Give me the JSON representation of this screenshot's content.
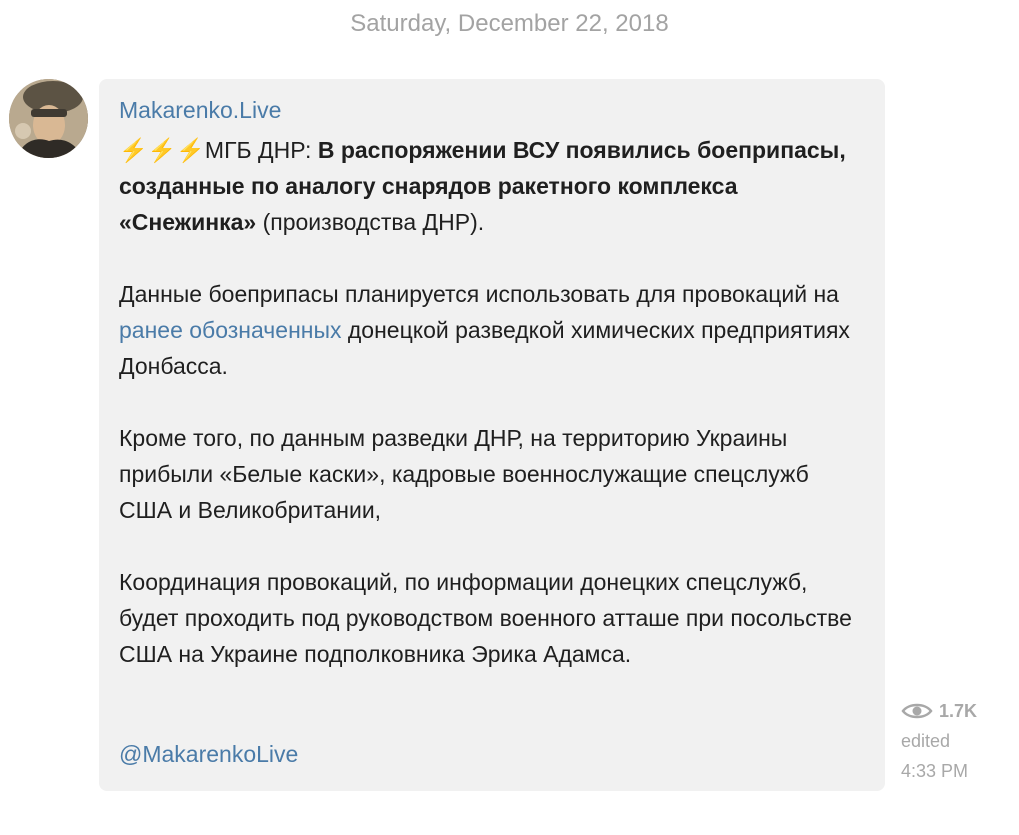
{
  "date_header": "Saturday, December 22, 2018",
  "message": {
    "channel_name": "Makarenko.Live",
    "p1": {
      "bolts": "⚡⚡⚡",
      "prefix": "МГБ ДНР: ",
      "bold": "В распоряжении ВСУ появились боеприпасы, созданные по аналогу снарядов ракетного комплекса «Снежинка»",
      "suffix": " (производства ДНР)."
    },
    "p2": {
      "before_link": "Данные боеприпасы планируется использовать для провокаций на ",
      "link": "ранее обозначенных",
      "after_link": " донецкой разведкой химических предприятиях Донбасса."
    },
    "p3": "Кроме того, по данным разведки ДНР, на территорию Украины прибыли «Белые каски», кадровые военнослужащие спецслужб США и Великобритании,",
    "p4": "Координация провокаций, по информации донецких спецслужб, будет проходить под руководством военного атташе при посольстве США на Украине подполковника Эрика Адамса.",
    "handle": "@MakarenkoLive"
  },
  "meta": {
    "views": "1.7K",
    "edited": "edited",
    "time": "4:33 PM"
  },
  "icons": {
    "views": "eye-icon",
    "avatar": "channel-avatar"
  },
  "colors": {
    "bubble_bg": "#f1f1f1",
    "link": "#4a7ba8",
    "meta": "#a8a8a8",
    "date": "#a3a3a3",
    "bolt": "#f4b400"
  }
}
